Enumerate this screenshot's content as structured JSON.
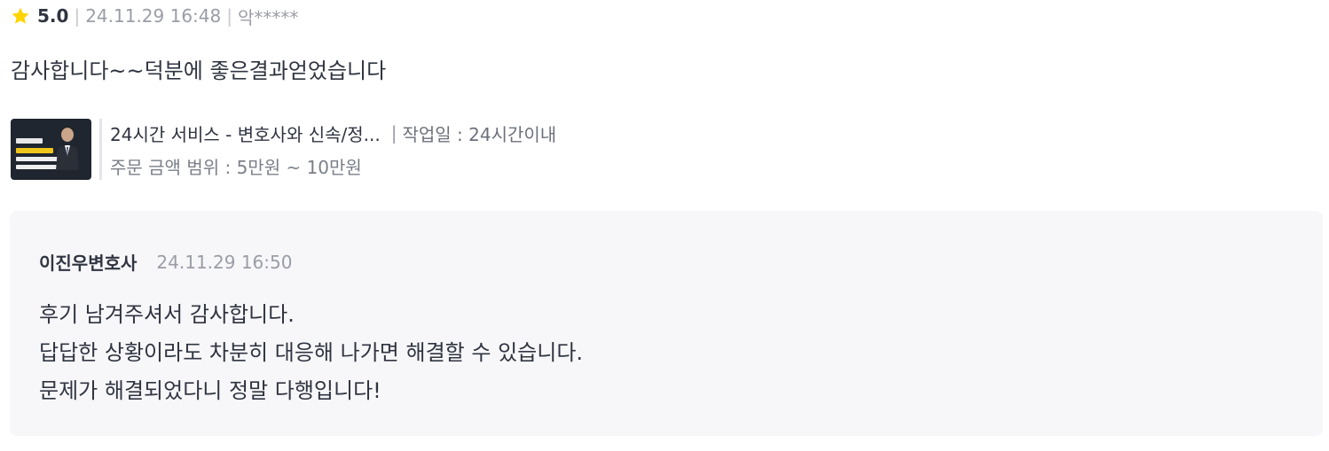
{
  "review": {
    "rating": "5.0",
    "date": "24.11.29 16:48",
    "author": "악*****",
    "text": "감사합니다~~덕분에 좋은결과얻었습니다"
  },
  "service": {
    "title": "24시간 서비스 - 변호사와 신속/정...",
    "workday": "작업일 : 24시간이내",
    "price_range": "주문 금액 범위 : 5만원 ~ 10만원"
  },
  "reply": {
    "author": "이진우변호사",
    "date": "24.11.29 16:50",
    "lines": [
      "후기 남겨주셔서 감사합니다.",
      "답답한 상황이라도 차분히 대응해 나가면 해결할 수 있습니다.",
      "문제가 해결되었다니 정말 다행입니다!"
    ]
  },
  "colors": {
    "star": "#FFD400",
    "reply_background": "#F7F7F9"
  }
}
